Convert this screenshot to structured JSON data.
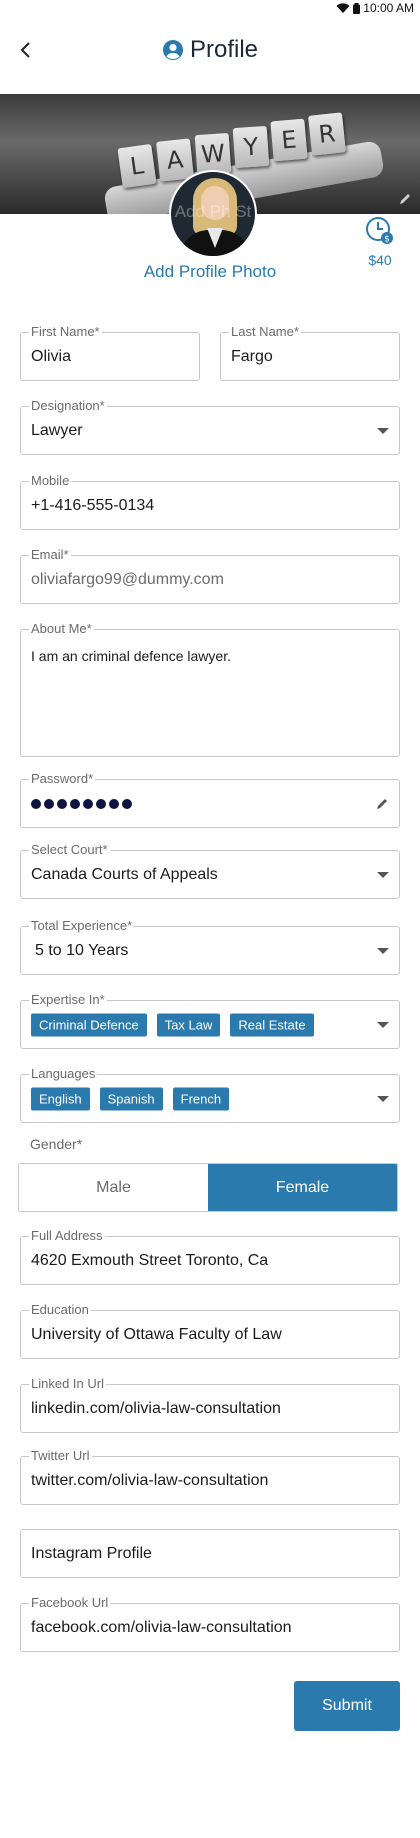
{
  "status_bar": {
    "time": "10:00 AM"
  },
  "header": {
    "title": "Profile",
    "icons": {
      "back": "chevron-left-icon",
      "profile": "user-circle-icon"
    }
  },
  "cover": {
    "tiles": [
      "L",
      "A",
      "W",
      "Y",
      "E",
      "R"
    ],
    "avatar_overlay_text": "Add Ph St"
  },
  "add_photo_label": "Add Profile Photo",
  "consultation_fee": "$40",
  "form": {
    "first_name": {
      "label": "First Name*",
      "value": "Olivia"
    },
    "last_name": {
      "label": "Last Name*",
      "value": "Fargo"
    },
    "designation": {
      "label": "Designation*",
      "value": "Lawyer"
    },
    "mobile": {
      "label": "Mobile",
      "value": "+1-416-555-0134"
    },
    "email": {
      "label": "Email*",
      "value": "oliviafargo99@dummy.com"
    },
    "about_me": {
      "label": "About Me*",
      "value": "I am an criminal defence lawyer."
    },
    "password": {
      "label": "Password*",
      "masked_length": 8
    },
    "court": {
      "label": "Select Court*",
      "value": "Canada Courts of Appeals"
    },
    "experience": {
      "label": "Total Experience*",
      "value": "5 to 10 Years"
    },
    "expertise": {
      "label": "Expertise In*",
      "chips": [
        "Criminal Defence",
        "Tax Law",
        "Real Estate"
      ]
    },
    "languages": {
      "label": "Languages",
      "chips": [
        "English",
        "Spanish",
        "French"
      ]
    },
    "gender": {
      "label": "Gender*",
      "options": [
        "Male",
        "Female"
      ],
      "selected": "Female"
    },
    "address": {
      "label": "Full Address",
      "value": "4620  Exmouth Street Toronto, Ca"
    },
    "education": {
      "label": "Education",
      "value": "University of Ottawa Faculty of Law"
    },
    "linkedin": {
      "label": "Linked In Url",
      "value": "linkedin.com/olivia-law-consultation"
    },
    "twitter": {
      "label": "Twitter Url",
      "value": "twitter.com/olivia-law-consultation"
    },
    "instagram": {
      "placeholder": "Instagram Profile"
    },
    "facebook": {
      "label": "Facebook Url",
      "value": "facebook.com/olivia-law-consultation"
    }
  },
  "submit_label": "Submit",
  "colors": {
    "accent": "#2a7aae",
    "border": "#c8c8c8",
    "label": "#6b6b6b"
  }
}
